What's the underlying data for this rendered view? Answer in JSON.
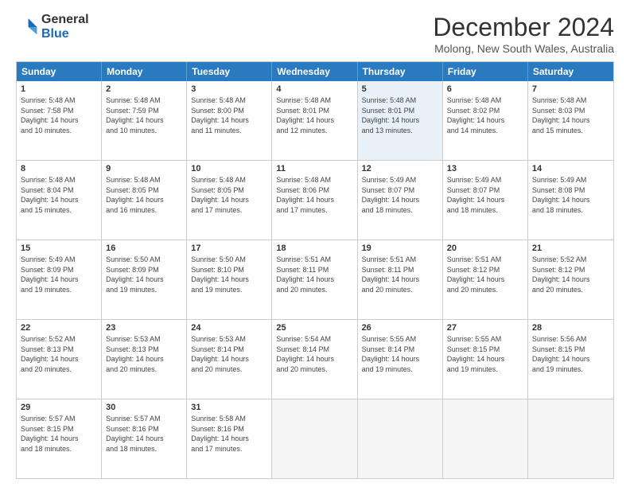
{
  "logo": {
    "general": "General",
    "blue": "Blue"
  },
  "title": "December 2024",
  "subtitle": "Molong, New South Wales, Australia",
  "weekdays": [
    "Sunday",
    "Monday",
    "Tuesday",
    "Wednesday",
    "Thursday",
    "Friday",
    "Saturday"
  ],
  "weeks": [
    [
      {
        "day": "1",
        "info": "Sunrise: 5:48 AM\nSunset: 7:58 PM\nDaylight: 14 hours\nand 10 minutes."
      },
      {
        "day": "2",
        "info": "Sunrise: 5:48 AM\nSunset: 7:59 PM\nDaylight: 14 hours\nand 10 minutes."
      },
      {
        "day": "3",
        "info": "Sunrise: 5:48 AM\nSunset: 8:00 PM\nDaylight: 14 hours\nand 11 minutes."
      },
      {
        "day": "4",
        "info": "Sunrise: 5:48 AM\nSunset: 8:01 PM\nDaylight: 14 hours\nand 12 minutes."
      },
      {
        "day": "5",
        "info": "Sunrise: 5:48 AM\nSunset: 8:01 PM\nDaylight: 14 hours\nand 13 minutes.",
        "highlight": true
      },
      {
        "day": "6",
        "info": "Sunrise: 5:48 AM\nSunset: 8:02 PM\nDaylight: 14 hours\nand 14 minutes."
      },
      {
        "day": "7",
        "info": "Sunrise: 5:48 AM\nSunset: 8:03 PM\nDaylight: 14 hours\nand 15 minutes."
      }
    ],
    [
      {
        "day": "8",
        "info": "Sunrise: 5:48 AM\nSunset: 8:04 PM\nDaylight: 14 hours\nand 15 minutes."
      },
      {
        "day": "9",
        "info": "Sunrise: 5:48 AM\nSunset: 8:05 PM\nDaylight: 14 hours\nand 16 minutes."
      },
      {
        "day": "10",
        "info": "Sunrise: 5:48 AM\nSunset: 8:05 PM\nDaylight: 14 hours\nand 17 minutes."
      },
      {
        "day": "11",
        "info": "Sunrise: 5:48 AM\nSunset: 8:06 PM\nDaylight: 14 hours\nand 17 minutes."
      },
      {
        "day": "12",
        "info": "Sunrise: 5:49 AM\nSunset: 8:07 PM\nDaylight: 14 hours\nand 18 minutes."
      },
      {
        "day": "13",
        "info": "Sunrise: 5:49 AM\nSunset: 8:07 PM\nDaylight: 14 hours\nand 18 minutes."
      },
      {
        "day": "14",
        "info": "Sunrise: 5:49 AM\nSunset: 8:08 PM\nDaylight: 14 hours\nand 18 minutes."
      }
    ],
    [
      {
        "day": "15",
        "info": "Sunrise: 5:49 AM\nSunset: 8:09 PM\nDaylight: 14 hours\nand 19 minutes."
      },
      {
        "day": "16",
        "info": "Sunrise: 5:50 AM\nSunset: 8:09 PM\nDaylight: 14 hours\nand 19 minutes."
      },
      {
        "day": "17",
        "info": "Sunrise: 5:50 AM\nSunset: 8:10 PM\nDaylight: 14 hours\nand 19 minutes."
      },
      {
        "day": "18",
        "info": "Sunrise: 5:51 AM\nSunset: 8:11 PM\nDaylight: 14 hours\nand 20 minutes."
      },
      {
        "day": "19",
        "info": "Sunrise: 5:51 AM\nSunset: 8:11 PM\nDaylight: 14 hours\nand 20 minutes."
      },
      {
        "day": "20",
        "info": "Sunrise: 5:51 AM\nSunset: 8:12 PM\nDaylight: 14 hours\nand 20 minutes."
      },
      {
        "day": "21",
        "info": "Sunrise: 5:52 AM\nSunset: 8:12 PM\nDaylight: 14 hours\nand 20 minutes."
      }
    ],
    [
      {
        "day": "22",
        "info": "Sunrise: 5:52 AM\nSunset: 8:13 PM\nDaylight: 14 hours\nand 20 minutes."
      },
      {
        "day": "23",
        "info": "Sunrise: 5:53 AM\nSunset: 8:13 PM\nDaylight: 14 hours\nand 20 minutes."
      },
      {
        "day": "24",
        "info": "Sunrise: 5:53 AM\nSunset: 8:14 PM\nDaylight: 14 hours\nand 20 minutes."
      },
      {
        "day": "25",
        "info": "Sunrise: 5:54 AM\nSunset: 8:14 PM\nDaylight: 14 hours\nand 20 minutes."
      },
      {
        "day": "26",
        "info": "Sunrise: 5:55 AM\nSunset: 8:14 PM\nDaylight: 14 hours\nand 19 minutes."
      },
      {
        "day": "27",
        "info": "Sunrise: 5:55 AM\nSunset: 8:15 PM\nDaylight: 14 hours\nand 19 minutes."
      },
      {
        "day": "28",
        "info": "Sunrise: 5:56 AM\nSunset: 8:15 PM\nDaylight: 14 hours\nand 19 minutes."
      }
    ],
    [
      {
        "day": "29",
        "info": "Sunrise: 5:57 AM\nSunset: 8:15 PM\nDaylight: 14 hours\nand 18 minutes."
      },
      {
        "day": "30",
        "info": "Sunrise: 5:57 AM\nSunset: 8:16 PM\nDaylight: 14 hours\nand 18 minutes."
      },
      {
        "day": "31",
        "info": "Sunrise: 5:58 AM\nSunset: 8:16 PM\nDaylight: 14 hours\nand 17 minutes."
      },
      {
        "day": "",
        "info": ""
      },
      {
        "day": "",
        "info": ""
      },
      {
        "day": "",
        "info": ""
      },
      {
        "day": "",
        "info": ""
      }
    ]
  ]
}
